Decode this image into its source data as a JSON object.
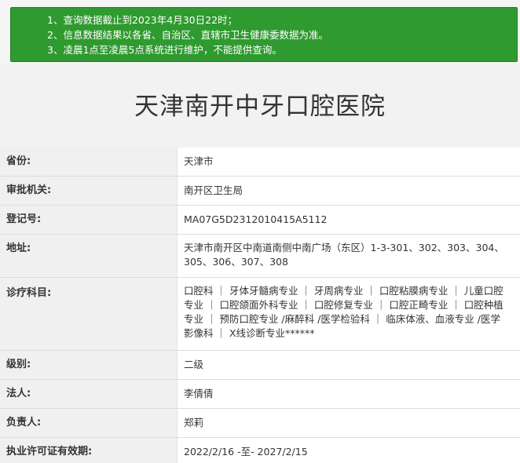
{
  "notice": {
    "lines": [
      "1、查询数据截止到2023年4月30日22时；",
      "2、信息数据结果以各省、自治区、直辖市卫生健康委数据为准。",
      "3、凌晨1点至凌晨5点系统进行维护，不能提供查询。"
    ]
  },
  "page_title": "天津南开中牙口腔医院",
  "fields": [
    {
      "label": "省份:",
      "value": "天津市"
    },
    {
      "label": "审批机关:",
      "value": "南开区卫生局"
    },
    {
      "label": "登记号:",
      "value": "MA07G5D2312010415A5112"
    },
    {
      "label": "地址:",
      "value": "天津市南开区中南道南侧中南广场（东区）1-3-301、302、303、304、305、306、307、308"
    },
    {
      "label": "诊疗科目:",
      "value": "口腔科 ｜ 牙体牙髓病专业 ｜ 牙周病专业 ｜ 口腔粘膜病专业 ｜ 儿童口腔专业 ｜ 口腔颌面外科专业 ｜ 口腔修复专业 ｜ 口腔正畸专业 ｜ 口腔种植专业 ｜ 预防口腔专业 /麻醉科 /医学检验科 ｜ 临床体液、血液专业 /医学影像科 ｜ X线诊断专业******"
    },
    {
      "label": "级别:",
      "value": "二级"
    },
    {
      "label": "法人:",
      "value": "李倩倩"
    },
    {
      "label": "负责人:",
      "value": "郑莉"
    },
    {
      "label": "执业许可证有效期:",
      "value": "2022/2/16 -至- 2027/2/15"
    }
  ]
}
